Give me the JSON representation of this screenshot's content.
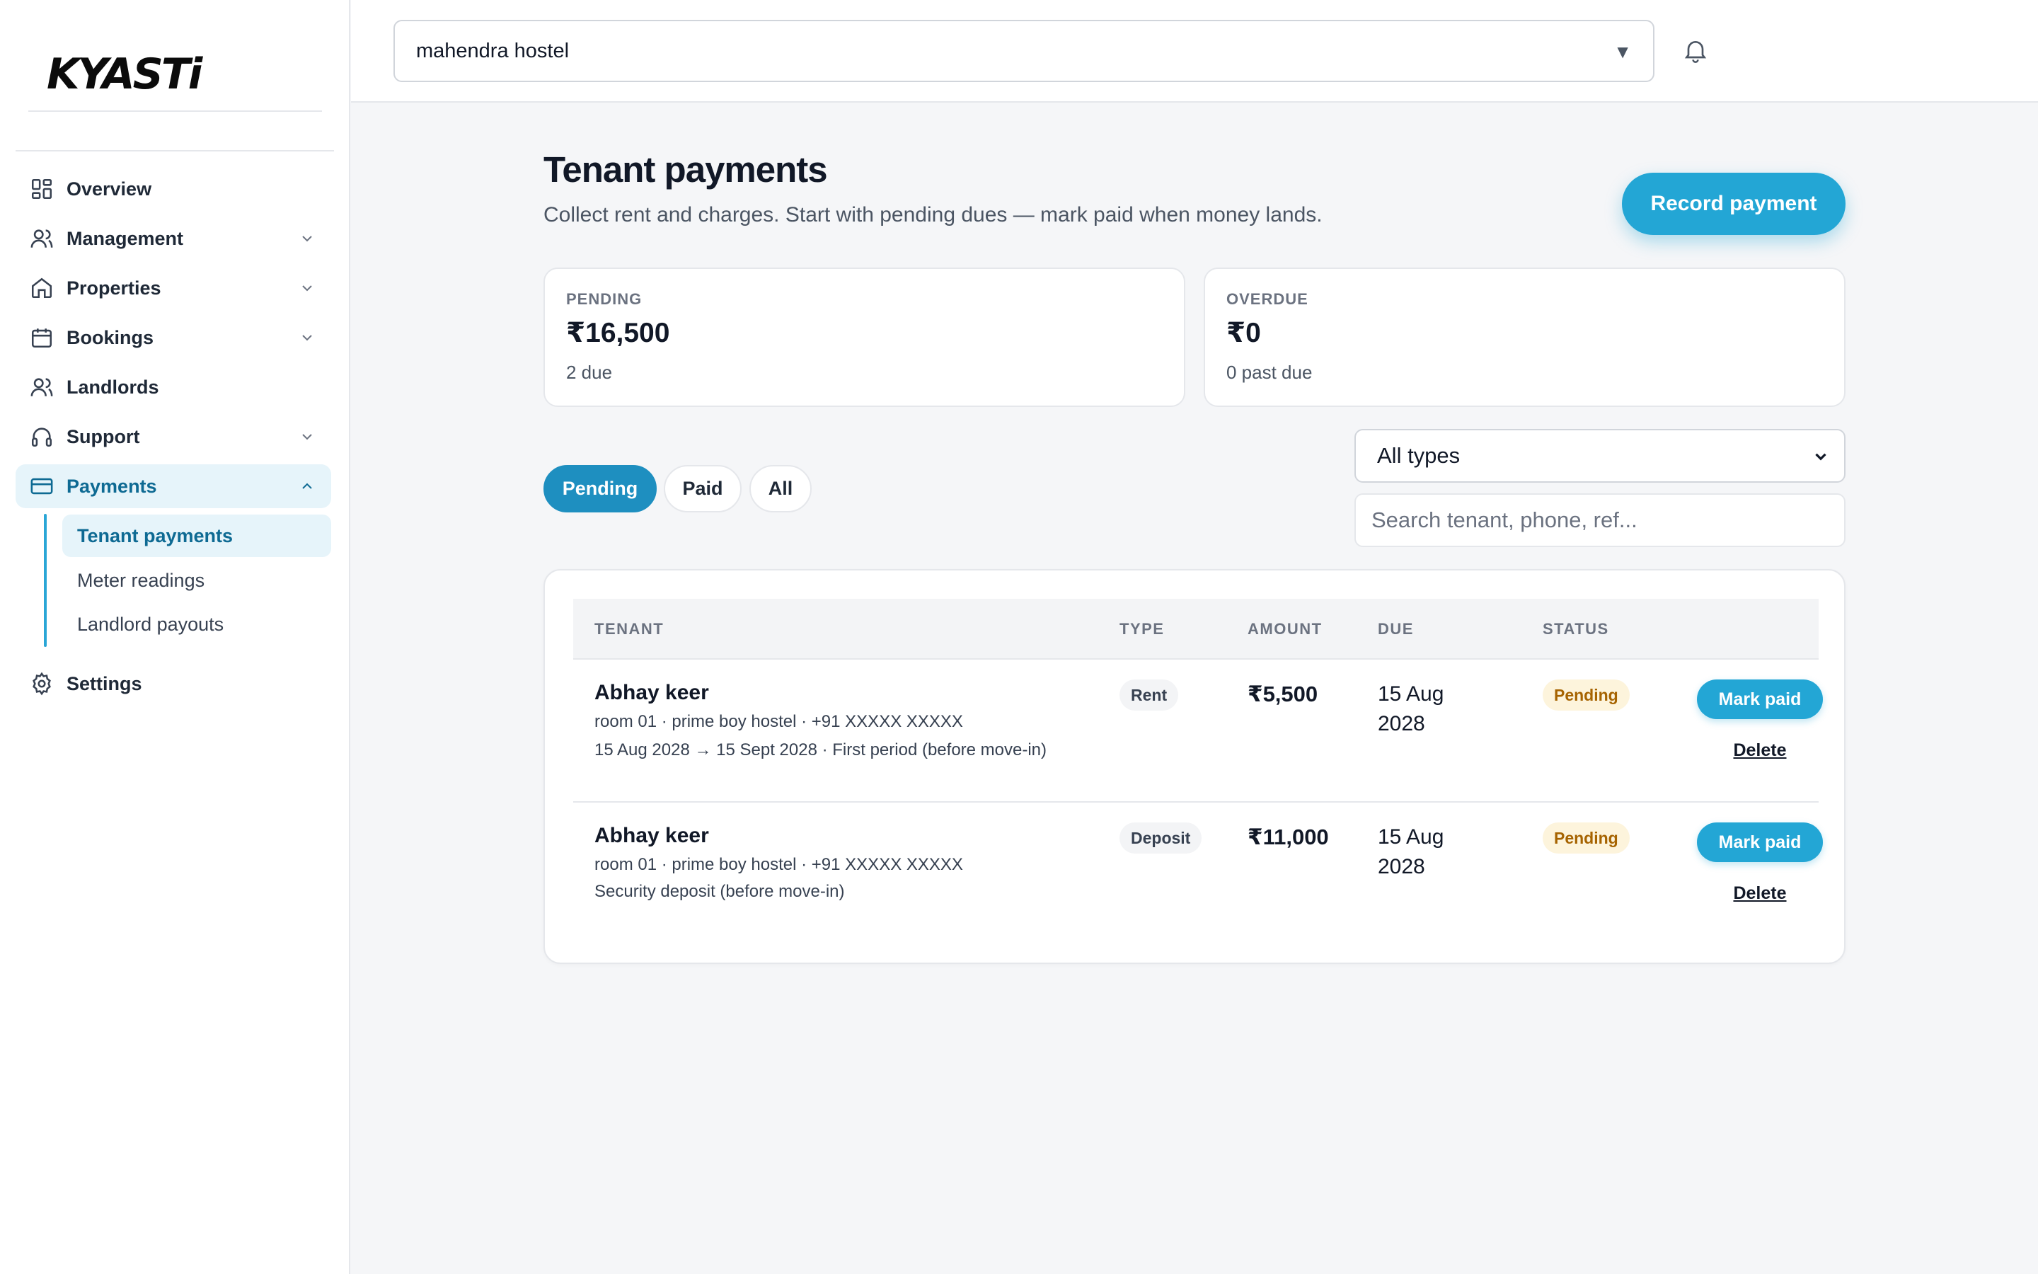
{
  "brand": {
    "logo_text": "KYASTi",
    "accent": "#23a6d5"
  },
  "sidebar": {
    "items": [
      {
        "label": "Overview",
        "icon": "grid-icon"
      },
      {
        "label": "Management",
        "icon": "users-icon"
      },
      {
        "label": "Properties",
        "icon": "home-icon"
      },
      {
        "label": "Bookings",
        "icon": "calendar-icon"
      },
      {
        "label": "Landlords",
        "icon": "users-icon"
      },
      {
        "label": "Support",
        "icon": "headset-icon"
      },
      {
        "label": "Payments",
        "icon": "credit-card-icon"
      },
      {
        "label": "Settings",
        "icon": "gear-icon"
      }
    ],
    "payments_sub": [
      {
        "label": "Tenant payments"
      },
      {
        "label": "Meter readings"
      },
      {
        "label": "Landlord payouts"
      }
    ]
  },
  "topbar": {
    "hostel_selected": "mahendra hostel",
    "caret": "▼"
  },
  "page": {
    "title": "Tenant payments",
    "subtitle": "Collect rent and charges. Start with pending dues — mark paid when money lands.",
    "record_button": "Record payment"
  },
  "stats": {
    "pending": {
      "label": "PENDING",
      "value": "₹16,500",
      "note": "2 due"
    },
    "overdue": {
      "label": "OVERDUE",
      "value": "₹0",
      "note": "0 past due"
    }
  },
  "filters": {
    "tabs": [
      "Pending",
      "Paid",
      "All"
    ],
    "active_tab": "Pending",
    "type_selected": "All types",
    "search_placeholder": "Search tenant, phone, ref..."
  },
  "table": {
    "headers": [
      "TENANT",
      "TYPE",
      "AMOUNT",
      "DUE",
      "STATUS"
    ],
    "rows": [
      {
        "name": "Abhay keer",
        "meta1": "room 01 · prime boy hostel · +91 XXXXX XXXXX",
        "meta2": "15 Aug 2028 → 15 Sept 2028 · First period (before move-in)",
        "type": "Rent",
        "amount": "₹5,500",
        "due": "15 Aug 2028",
        "status": "Pending",
        "action": "Mark paid",
        "delete": "Delete"
      },
      {
        "name": "Abhay keer",
        "meta1": "room 01 · prime boy hostel · +91 XXXXX XXXXX",
        "meta2": "Security deposit (before move-in)",
        "type": "Deposit",
        "amount": "₹11,000",
        "due": "15 Aug 2028",
        "status": "Pending",
        "action": "Mark paid",
        "delete": "Delete"
      }
    ]
  }
}
